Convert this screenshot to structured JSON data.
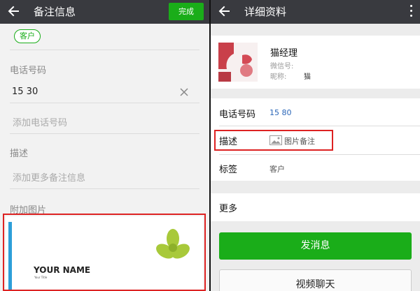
{
  "left": {
    "title": "备注信息",
    "done_label": "完成",
    "tag": "客户",
    "phone_label": "电话号码",
    "phone_value": "15          30",
    "add_phone_placeholder": "添加电话号码",
    "desc_label": "描述",
    "desc_placeholder": "添加更多备注信息",
    "photo_label": "附加图片",
    "card": {
      "name": "YOUR NAME",
      "title": "Your Title"
    }
  },
  "right": {
    "title": "详细资料",
    "profile": {
      "name": "猫经理",
      "wechat_prefix": "微信号:",
      "nickname_prefix": "昵称:",
      "nickname_value": "猫"
    },
    "rows": {
      "phone_label": "电话号码",
      "phone_value": "15          80",
      "desc_label": "描述",
      "desc_value": "图片备注",
      "tag_label": "标签",
      "tag_value": "客户"
    },
    "more_label": "更多",
    "send_message": "发消息",
    "video_call": "视频聊天"
  },
  "colors": {
    "accent_green": "#1aad19",
    "topbar": "#393a3f",
    "highlight_red": "#dd2222",
    "card_stripe": "#2d9fd9",
    "clover": "#a8c93a"
  },
  "icons": [
    "back-arrow-icon",
    "clear-icon",
    "more-vert-icon",
    "image-icon",
    "clover-logo-icon"
  ]
}
